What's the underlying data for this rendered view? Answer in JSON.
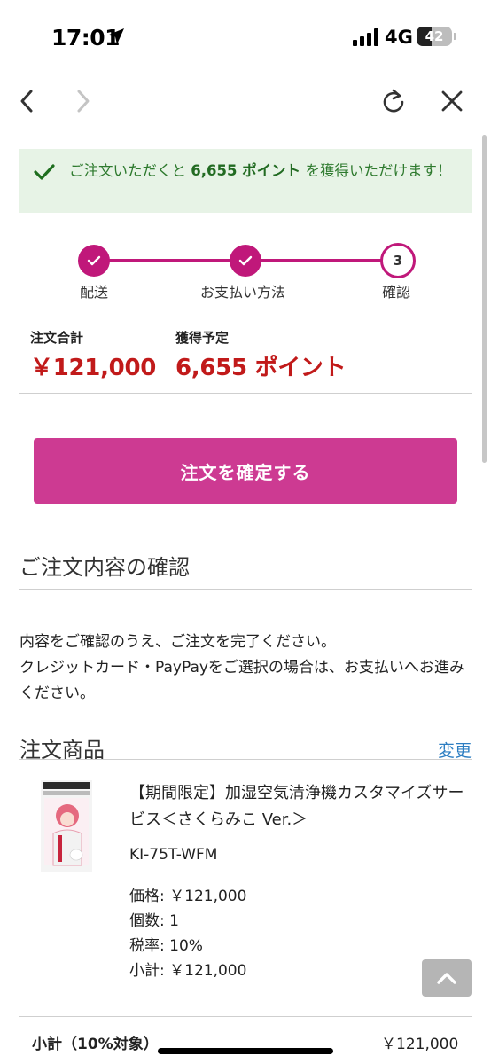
{
  "status_bar": {
    "time": "17:01",
    "network": "4G",
    "battery": "42",
    "battery_level": 0.42
  },
  "points_banner": {
    "text_before": "ご注文いただくと",
    "points": "6,655 ポイント",
    "text_after": "を獲得いただけます！"
  },
  "steps": [
    {
      "label": "配送",
      "state": "done"
    },
    {
      "label": "お支払い方法",
      "state": "done"
    },
    {
      "label": "確認",
      "state": "current",
      "number": "3"
    }
  ],
  "summary": {
    "total_label": "注文合計",
    "total_value": "￥121,000",
    "points_label": "獲得予定",
    "points_value": "6,655 ポイント"
  },
  "confirm_button": "注文を確定する",
  "confirm_section": {
    "title": "ご注文内容の確認",
    "description_line1": "内容をご確認のうえ、ご注文を完了ください。",
    "description_line2": "クレジットカード・PayPayをご選択の場合は、お支払いへお進みください。"
  },
  "products_section": {
    "title": "注文商品",
    "change_link": "変更"
  },
  "product": {
    "name": "【期間限定】加湿空気清浄機カスタマイズサービス＜さくらみこ Ver.＞",
    "code": "KI-75T-WFM",
    "price": "価格: ￥121,000",
    "quantity": "個数: 1",
    "tax_rate": "税率: 10%",
    "subtotal": "小計: ￥121,000"
  },
  "subtotal_row": {
    "label": "小計（10%対象）",
    "value": "￥121,000"
  },
  "colors": {
    "accent": "#c0187a",
    "button": "#cd3a92",
    "price_red": "#c11a1a",
    "banner_bg": "#e7f3e6",
    "banner_text": "#2e7a2e",
    "link": "#2d7ec2"
  }
}
